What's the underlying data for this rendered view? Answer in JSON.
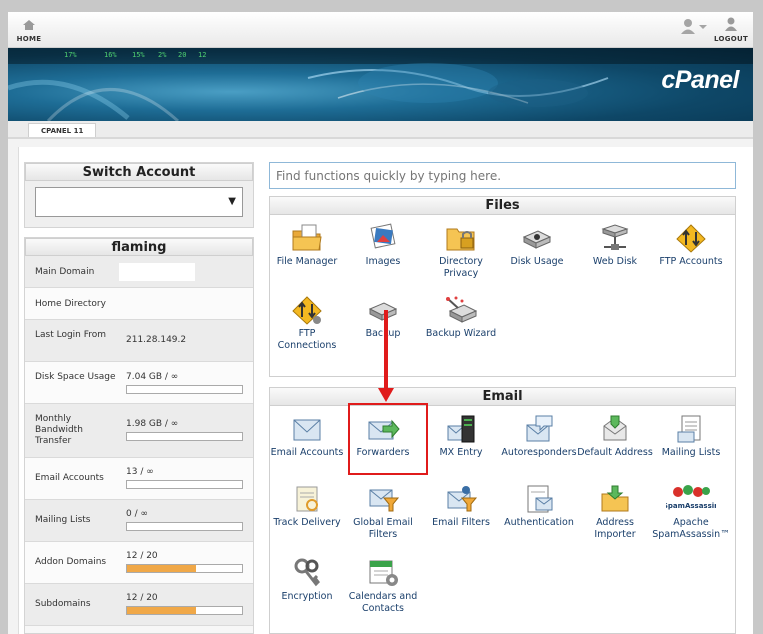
{
  "topbar": {
    "home_label": "HOME",
    "logout_label": "LOGOUT"
  },
  "banner": {
    "logo_text": "cPanel",
    "tickers": [
      "17%",
      "16%",
      "15%",
      "2%",
      "20",
      "12"
    ]
  },
  "tabbar": {
    "version": "CPANEL 11"
  },
  "switch_account": {
    "title": "Switch Account",
    "selected": "",
    "arrow": "▼"
  },
  "stats": {
    "title": "flaming",
    "rows": [
      {
        "label": "Main Domain",
        "value": ""
      },
      {
        "label": "Home Directory",
        "value": ""
      },
      {
        "label": "Last Login From",
        "value": "211.28.149.2"
      },
      {
        "label": "Disk Space Usage",
        "value": "7.04 GB / ∞",
        "progress": 0.0
      },
      {
        "label": "Monthly Bandwidth Transfer",
        "value": "1.98 GB / ∞",
        "progress": 0.0
      },
      {
        "label": "Email Accounts",
        "value": "13 / ∞",
        "progress": 0.0
      },
      {
        "label": "Mailing Lists",
        "value": "0 / ∞",
        "progress": 0.0
      },
      {
        "label": "Addon Domains",
        "value": "12 / 20",
        "progress": 0.6
      },
      {
        "label": "Subdomains",
        "value": "12 / 20",
        "progress": 0.6
      }
    ]
  },
  "search": {
    "placeholder": "Find functions quickly by typing here."
  },
  "files": {
    "title": "Files",
    "items": [
      {
        "label": "File Manager",
        "icon": "file-manager-icon"
      },
      {
        "label": "Images",
        "icon": "images-icon"
      },
      {
        "label": "Directory Privacy",
        "icon": "directory-privacy-icon"
      },
      {
        "label": "Disk Usage",
        "icon": "disk-usage-icon"
      },
      {
        "label": "Web Disk",
        "icon": "web-disk-icon"
      },
      {
        "label": "FTP Accounts",
        "icon": "ftp-accounts-icon"
      },
      {
        "label": "FTP Connections",
        "icon": "ftp-connections-icon"
      },
      {
        "label": "Backup",
        "icon": "backup-icon"
      },
      {
        "label": "Backup Wizard",
        "icon": "backup-wizard-icon"
      }
    ]
  },
  "email": {
    "title": "Email",
    "items": [
      {
        "label": "Email Accounts",
        "icon": "email-accounts-icon"
      },
      {
        "label": "Forwarders",
        "icon": "forwarders-icon"
      },
      {
        "label": "MX Entry",
        "icon": "mx-entry-icon"
      },
      {
        "label": "Autoresponders",
        "icon": "autoresponders-icon"
      },
      {
        "label": "Default Address",
        "icon": "default-address-icon"
      },
      {
        "label": "Mailing Lists",
        "icon": "mailing-lists-icon"
      },
      {
        "label": "Track Delivery",
        "icon": "track-delivery-icon"
      },
      {
        "label": "Global Email Filters",
        "icon": "global-email-filters-icon"
      },
      {
        "label": "Email Filters",
        "icon": "email-filters-icon"
      },
      {
        "label": "Authentication",
        "icon": "authentication-icon"
      },
      {
        "label": "Address Importer",
        "icon": "address-importer-icon"
      },
      {
        "label": "Apache SpamAssassin™",
        "icon": "spamassassin-icon",
        "logo_text": "SpamAssassin"
      },
      {
        "label": "Encryption",
        "icon": "encryption-icon"
      },
      {
        "label": "Calendars and Contacts",
        "icon": "calendars-contacts-icon"
      }
    ]
  },
  "colors": {
    "accent": "#1a3f6b",
    "highlight": "#e01b1b",
    "progress": "#f0a848"
  }
}
